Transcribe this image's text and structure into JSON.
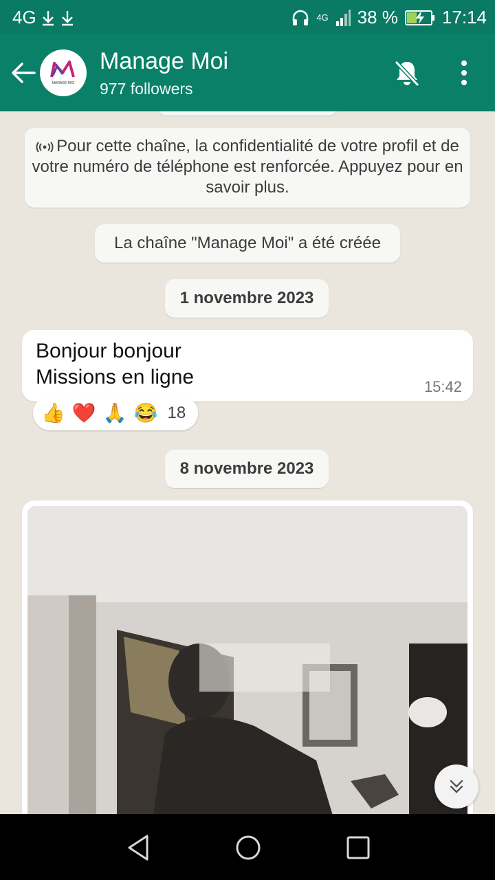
{
  "status_bar": {
    "network": "4G",
    "battery": "38 %",
    "time": "17:14",
    "network_small": "4G"
  },
  "channel": {
    "name": "Manage Moi",
    "followers": "977 followers",
    "avatar_text": "MANAGE MOI"
  },
  "messages": {
    "privacy_notice": "Pour cette chaîne, la confidentialité de votre profil et de votre numéro de téléphone est renforcée. Appuyez pour en savoir plus.",
    "created_notice": "La chaîne \"Manage Moi\" a été créée",
    "date_1": "1 novembre 2023",
    "message_line_1": "Bonjour bonjour",
    "message_line_2": "Missions en ligne",
    "message_time": "15:42",
    "reactions": [
      "👍",
      "❤️",
      "🙏",
      "😂"
    ],
    "reaction_count": "18",
    "date_2": "8 novembre 2023"
  },
  "icons": {
    "back": "arrow-back-icon",
    "mute": "bell-off-icon",
    "more": "more-vertical-icon",
    "scroll": "double-chevron-down-icon",
    "nav_back": "triangle-back-icon",
    "nav_home": "circle-home-icon",
    "nav_recents": "square-recents-icon"
  },
  "colors": {
    "header": "#0a8069",
    "status": "#0a7a64",
    "chat_bg": "#ebe6dd"
  }
}
